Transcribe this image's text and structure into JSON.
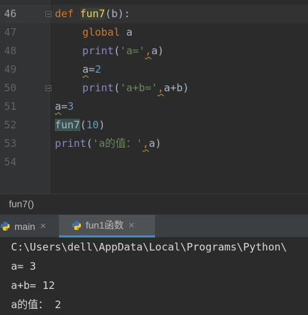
{
  "editor": {
    "line_numbers": [
      "46",
      "47",
      "48",
      "49",
      "50",
      "51",
      "52",
      "53",
      "54"
    ],
    "lines": {
      "l46": {
        "kw": "def",
        "fn": "fun7",
        "paren_open": "(",
        "param": "b",
        "rest": "):"
      },
      "l47": {
        "kw": "global",
        "var": "a"
      },
      "l48": {
        "builtin": "print",
        "open": "(",
        "str": "'a='",
        "comma": ",",
        "var": "a",
        "close": ")"
      },
      "l49": {
        "var": "a",
        "eq": "=",
        "num": "2"
      },
      "l50": {
        "builtin": "print",
        "open": "(",
        "str": "'a+b='",
        "comma": ",",
        "expr": "a+b",
        "close": ")"
      },
      "l51": {
        "var": "a",
        "eq": "=",
        "num": "3"
      },
      "l52": {
        "fn": "fun7",
        "open": "(",
        "num": "10",
        "close": ")"
      },
      "l53": {
        "builtin": "print",
        "open": "(",
        "str": "'a的值：'",
        "comma": ",",
        "var": "a",
        "close": ")"
      }
    }
  },
  "breadcrumb": {
    "text": "fun7()"
  },
  "run_tabs": [
    {
      "label": "main",
      "icon": "python-icon",
      "active": false
    },
    {
      "label": "fun1函数",
      "icon": "python-icon",
      "active": true
    }
  ],
  "close_glyph": "×",
  "console": {
    "lines": [
      "C:\\Users\\dell\\AppData\\Local\\Programs\\Python\\",
      "a= 3",
      "a+b= 12",
      "a的值： 2"
    ]
  },
  "colors": {
    "editor_bg": "#2b2b2b",
    "keyword": "#cc7832",
    "function": "#ffc66d",
    "builtin": "#8888c6",
    "string": "#6a8759",
    "number": "#6897bb",
    "active_tab_underline": "#4a88c7"
  }
}
